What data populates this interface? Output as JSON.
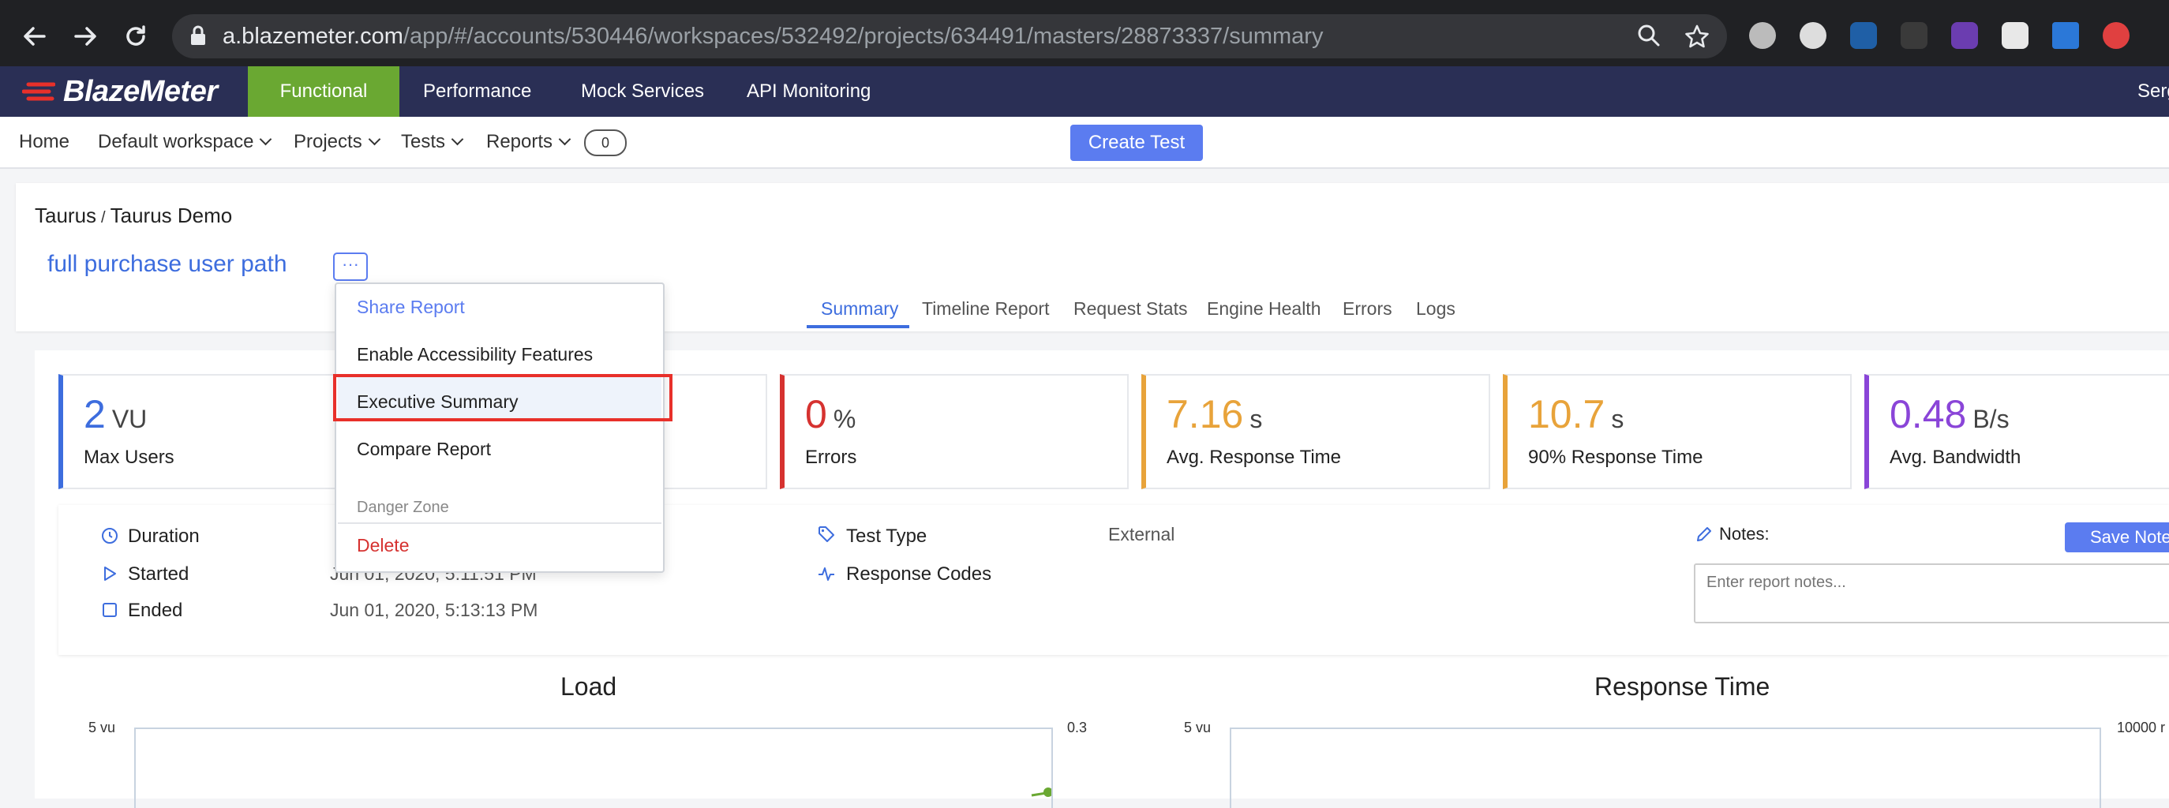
{
  "browser": {
    "url_host": "a.blazemeter.com",
    "url_path": "/app/#/accounts/530446/workspaces/532492/projects/634491/masters/28873337/summary"
  },
  "app": {
    "brand": "BlazeMeter",
    "top_nav": [
      "Functional",
      "Performance",
      "Mock Services",
      "API Monitoring"
    ],
    "user_partial": "Serg"
  },
  "subnav": {
    "home": "Home",
    "workspace": "Default workspace",
    "projects": "Projects",
    "tests": "Tests",
    "reports": "Reports",
    "reports_count": "0",
    "create_test": "Create Test"
  },
  "report": {
    "breadcrumb_project": "Taurus",
    "breadcrumb_sep": "/",
    "breadcrumb_test": "Taurus Demo",
    "title": "full purchase user path",
    "more": "···"
  },
  "tabs": [
    "Summary",
    "Timeline Report",
    "Request Stats",
    "Engine Health",
    "Errors",
    "Logs"
  ],
  "menu": {
    "share": "Share Report",
    "accessibility": "Enable Accessibility Features",
    "executive": "Executive Summary",
    "compare": "Compare Report",
    "danger_zone": "Danger Zone",
    "delete": "Delete"
  },
  "kpis": [
    {
      "value": "2",
      "unit": "VU",
      "label": "Max Users",
      "color": "#3d6dde"
    },
    {
      "value": "0",
      "unit": "%",
      "label": "Errors",
      "color": "#d63230"
    },
    {
      "value": "7.16",
      "unit": "s",
      "label": "Avg. Response Time",
      "color": "#e8a33a"
    },
    {
      "value": "10.7",
      "unit": "s",
      "label": "90% Response Time",
      "color": "#e8a33a"
    },
    {
      "value": "0.48",
      "unit": "B/s",
      "label": "Avg. Bandwidth",
      "color": "#8a45d8"
    }
  ],
  "info": {
    "duration_label": "Duration",
    "started_label": "Started",
    "started_value": "Jun 01, 2020, 5:11:51 PM",
    "ended_label": "Ended",
    "ended_value": "Jun 01, 2020, 5:13:13 PM",
    "test_type_label": "Test Type",
    "test_type_value": "External",
    "response_codes_label": "Response Codes",
    "notes_label": "Notes:",
    "save_notes": "Save Note",
    "notes_placeholder": "Enter report notes..."
  },
  "charts": {
    "load_title": "Load",
    "load_left_axis": "5 vu",
    "load_right_axis": "0.3",
    "response_title": "Response Time",
    "response_left_axis": "5 vu",
    "response_right_axis": "10000 r"
  }
}
